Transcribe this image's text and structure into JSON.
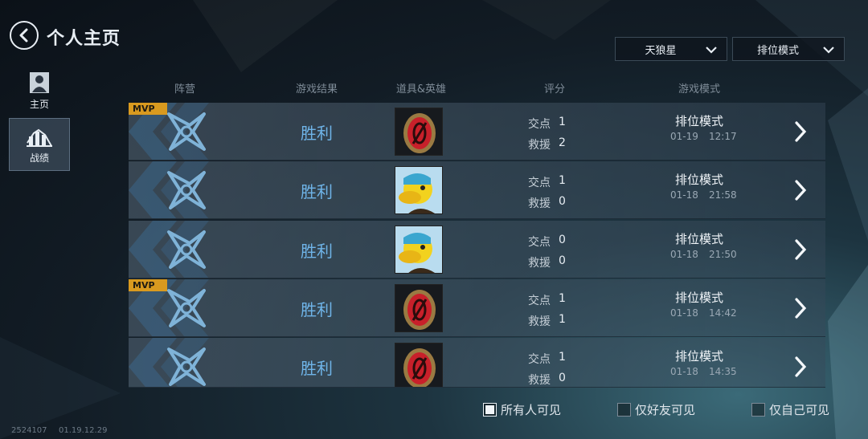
{
  "header": {
    "title": "个人主页"
  },
  "filters": {
    "season": "天狼星",
    "mode": "排位模式"
  },
  "sidebar": [
    {
      "label": "主页",
      "icon": "person-icon"
    },
    {
      "label": "战绩",
      "icon": "bar-chart-icon",
      "active": true
    }
  ],
  "columns": [
    "阵营",
    "游戏结果",
    "道具&英雄",
    "评分",
    "游戏模式"
  ],
  "score_labels": {
    "a": "交点",
    "b": "救援"
  },
  "rows": [
    {
      "mvp": "MVP",
      "result": "胜利",
      "item": "red-emblem",
      "a": "1",
      "b": "2",
      "mode": "排位模式",
      "date": "01-19",
      "time": "12:17"
    },
    {
      "mvp": "",
      "result": "胜利",
      "item": "duck-avatar",
      "a": "1",
      "b": "0",
      "mode": "排位模式",
      "date": "01-18",
      "time": "21:58"
    },
    {
      "mvp": "",
      "result": "胜利",
      "item": "duck-avatar",
      "a": "0",
      "b": "0",
      "mode": "排位模式",
      "date": "01-18",
      "time": "21:50"
    },
    {
      "mvp": "MVP",
      "result": "胜利",
      "item": "red-emblem",
      "a": "1",
      "b": "1",
      "mode": "排位模式",
      "date": "01-18",
      "time": "14:42"
    },
    {
      "mvp": "",
      "result": "胜利",
      "item": "red-emblem",
      "a": "1",
      "b": "0",
      "mode": "排位模式",
      "date": "01-18",
      "time": "14:35"
    }
  ],
  "visibility": [
    {
      "label": "所有人可见",
      "checked": true
    },
    {
      "label": "仅好友可见",
      "checked": false
    },
    {
      "label": "仅自己可见",
      "checked": false
    }
  ],
  "footer": {
    "id": "2524107",
    "timestamp": "01.19.12.29"
  },
  "colors": {
    "result": "#6fb4e8",
    "mvp": "#d99a1f",
    "camp_icon": "#7fb3d8"
  }
}
